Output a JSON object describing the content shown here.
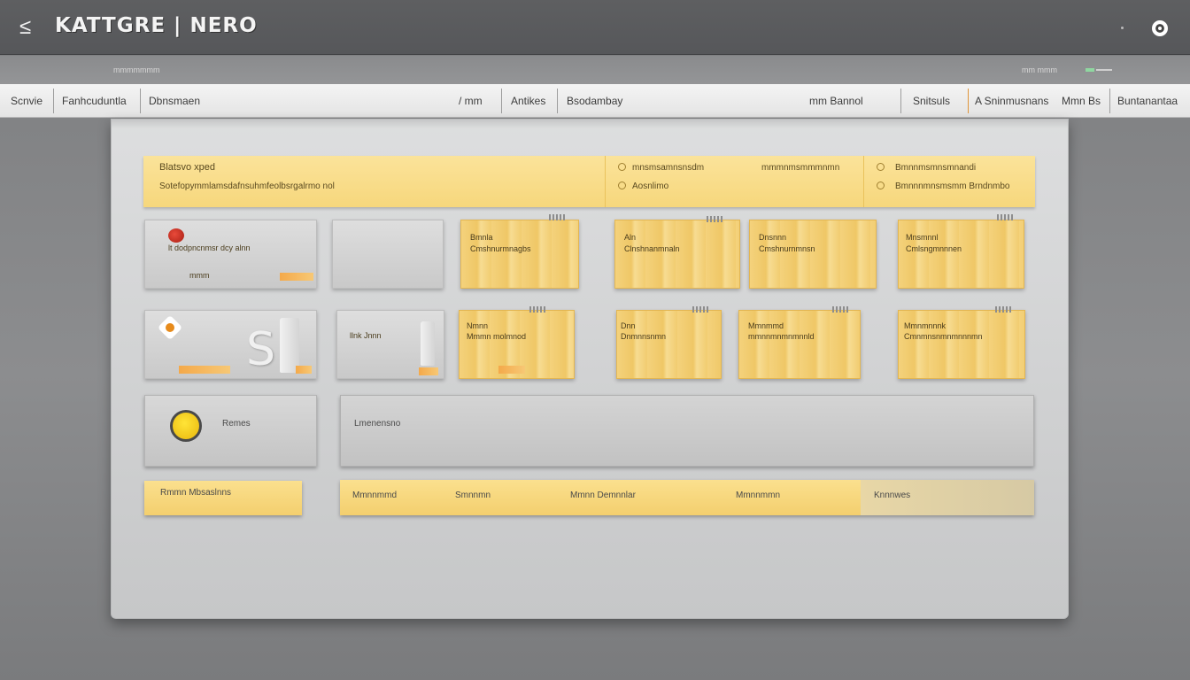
{
  "window": {
    "title": "KATTGRE | NERO",
    "back_icon": "back-arrow-icon",
    "status_icon": "status-indicator-icon"
  },
  "subbar": {
    "left_text": "mmmmmmm",
    "right_text": "mm mmm"
  },
  "tabs": [
    {
      "label": "Scnvie"
    },
    {
      "label": "Fanhcuduntla"
    },
    {
      "label": "Dbnsmaen"
    },
    {
      "label": "/ mm"
    },
    {
      "label": "Antikes"
    },
    {
      "label": "Bsodambay"
    },
    {
      "label": "mm Bannol"
    },
    {
      "label": "Snitsuls"
    },
    {
      "label": "A Sninmusnans"
    },
    {
      "label": "Mmn Bs"
    },
    {
      "label": "Buntanantaa"
    }
  ],
  "header": {
    "title": "Blatsvo xped",
    "subtitle": "Sotefopymmlamsdafnsuhmfeolbsrgalrmo nol",
    "col2_line1": "mnsmsamnsnsdm",
    "col2_line2": "Aosnlimo",
    "col3_line1": "mmmnmsmmmnmn",
    "col4_line1": "Bmnnmsmnsmnandi",
    "col4_line2": "Bmnnnmnsmsmm Brndnmbo"
  },
  "cards_row1": [
    {
      "label": "lt dodpncnmsr dcy alnn",
      "sub": "mmm"
    },
    {
      "label": ""
    },
    {
      "label": "Bmnla",
      "sub": "Cmshnurmnagbs"
    },
    {
      "label": "Aln",
      "sub": "Clnshnanmnaln"
    },
    {
      "label": "Dnsnnn",
      "sub": "Cmshnurnmnsn"
    },
    {
      "label": "Mnsmnnl",
      "sub": "Cmlsngmnnnen"
    }
  ],
  "cards_row2": [
    {
      "label": ""
    },
    {
      "label": "llnk Jnnn"
    },
    {
      "label": "Nmnn",
      "sub": "Mmmn molmnod"
    },
    {
      "label": "Dnn",
      "sub": "Dnmnnsnmn"
    },
    {
      "label": "Mmnmmd",
      "sub": "mmnnmnmnmnnld"
    },
    {
      "label": "Mmnmnnnk",
      "sub": "Cmnmnsnmnmnnnmn"
    }
  ],
  "info": {
    "left_label": "Remes",
    "right_label": "Lmenensno"
  },
  "footer": {
    "left_label": "Rmmn Mbsaslnns",
    "col1": "Mmnnmmd",
    "col2": "Smnnmn",
    "col3": "Mmnn Demnnlar",
    "col4": "Mmnnmmn",
    "col5": "Knnnwes"
  },
  "colors": {
    "accent_yellow": "#f6d77c",
    "title_bar": "#5e5f61",
    "panel": "#d6d7d8",
    "accent_orange": "#e0953a"
  }
}
